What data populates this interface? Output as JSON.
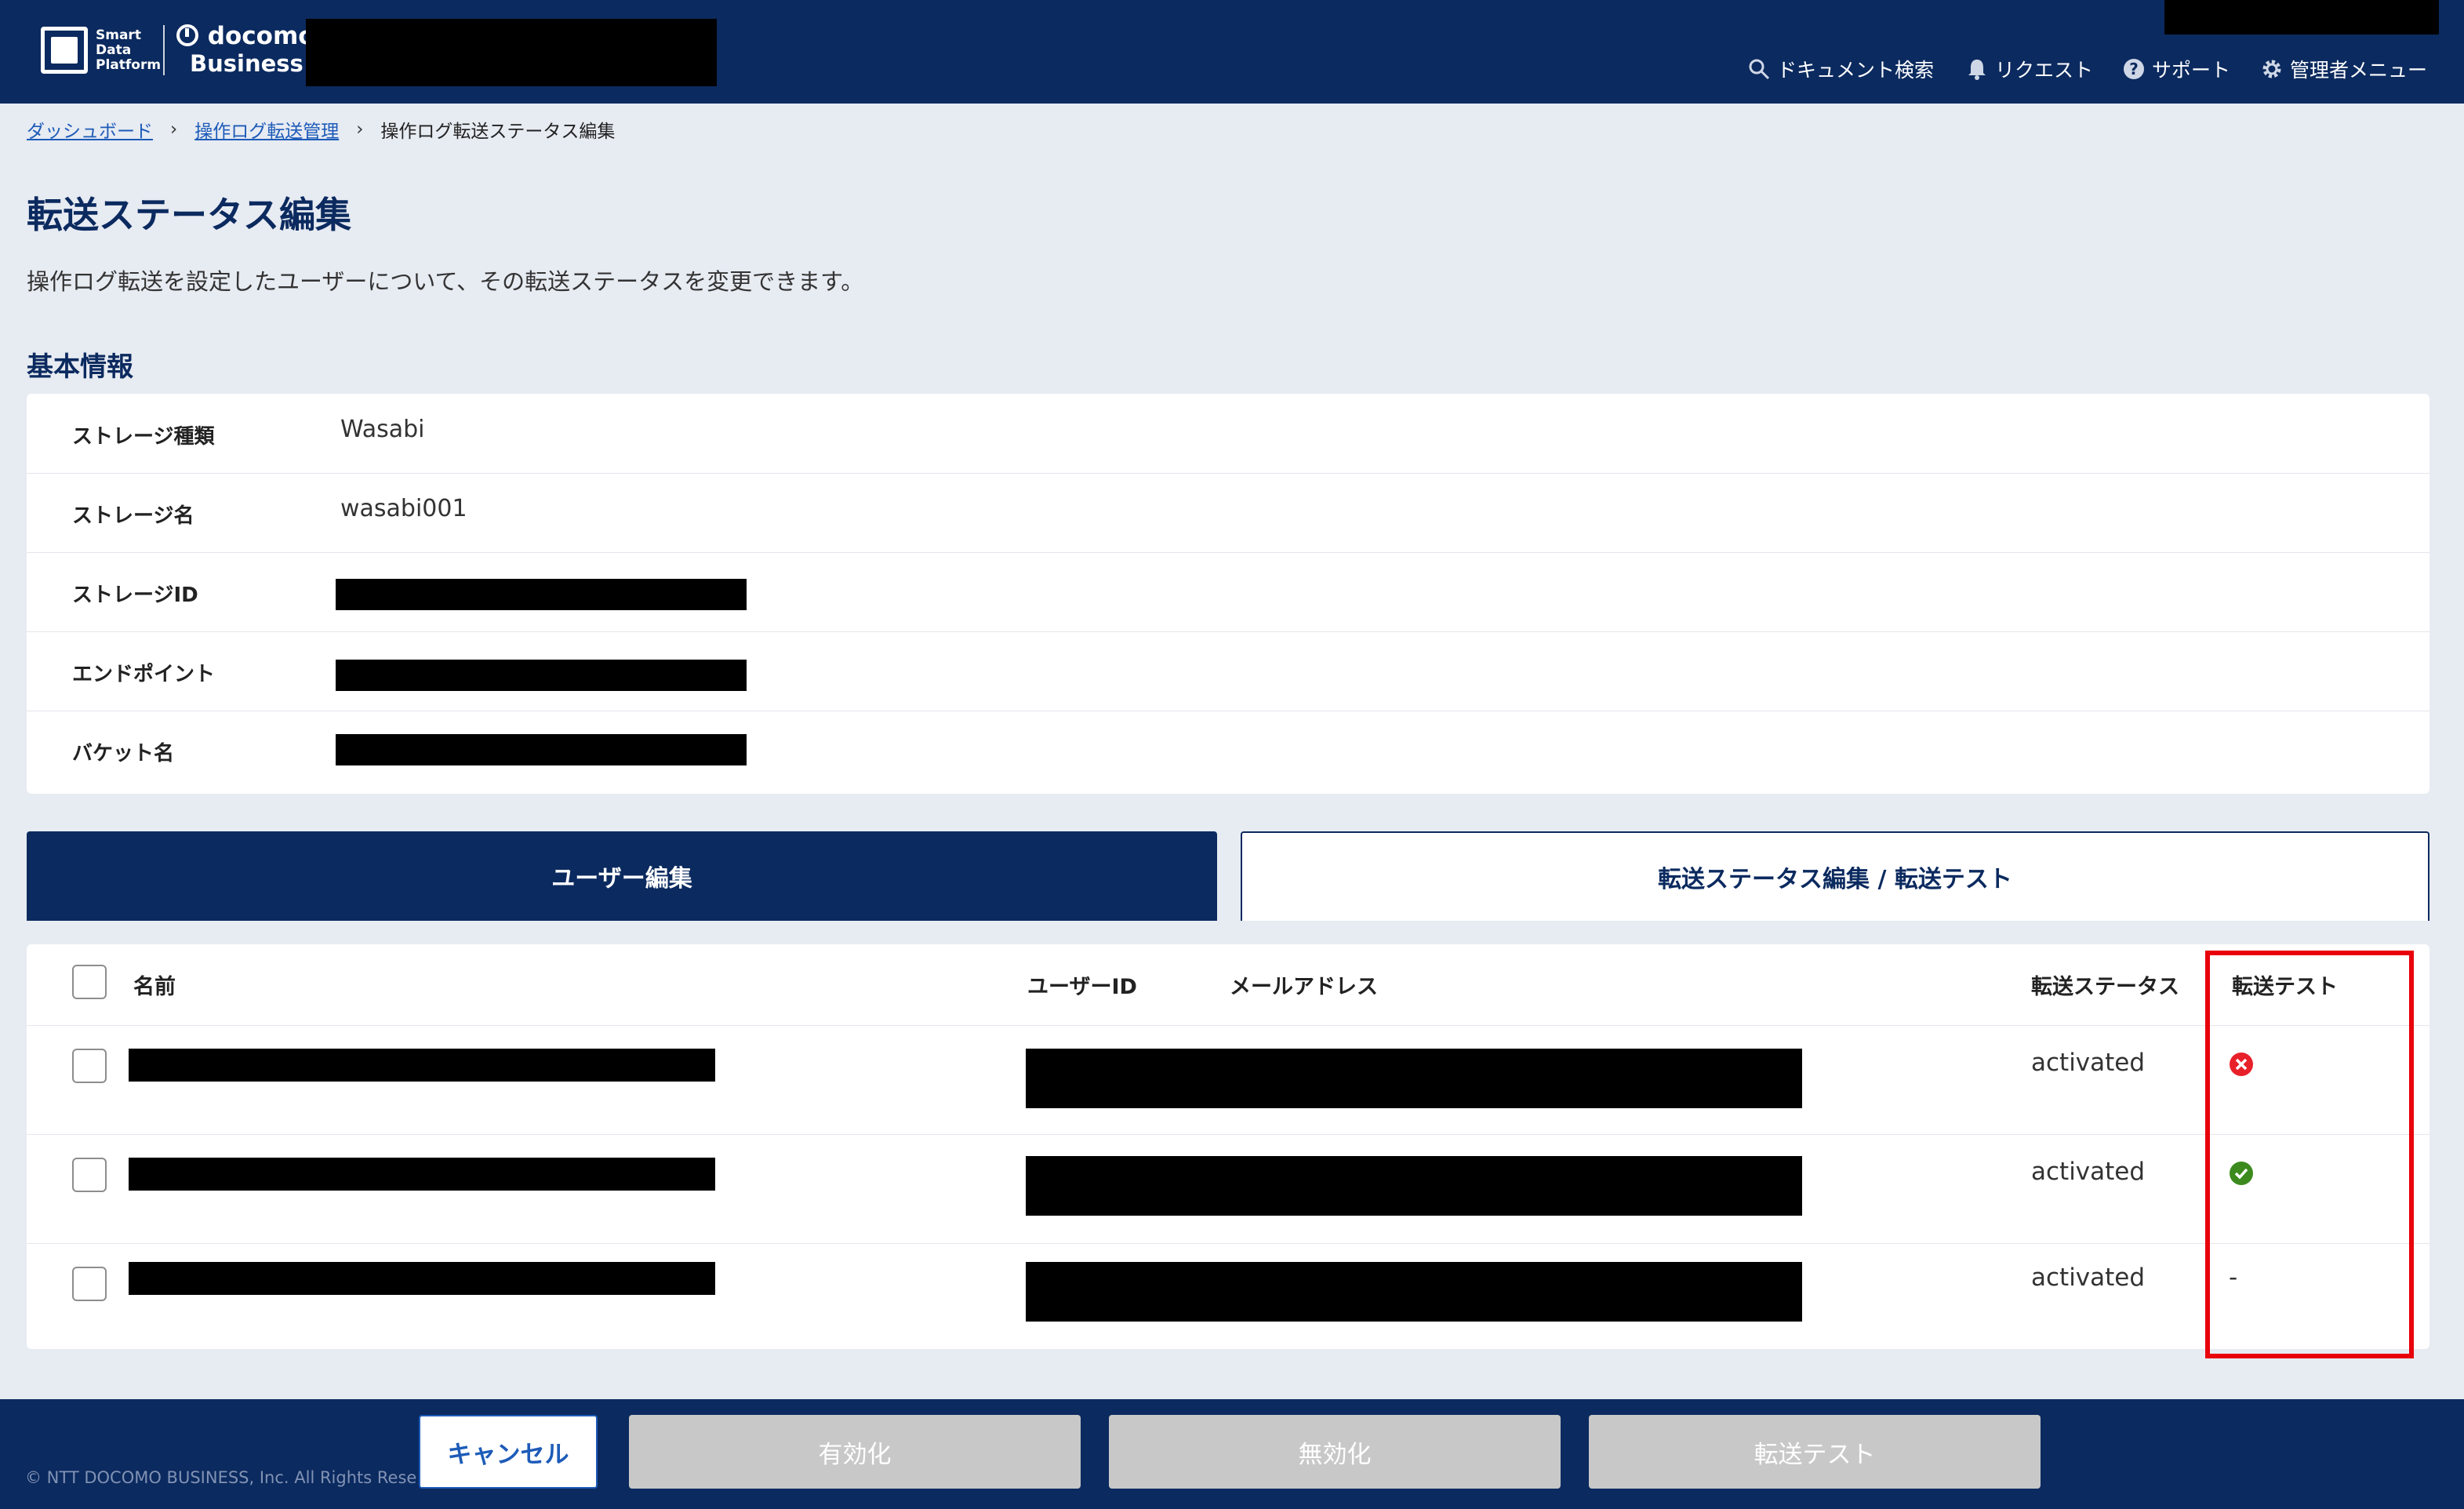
{
  "header": {
    "logo_line1": "Smart",
    "logo_line2": "Data",
    "logo_line3": "Platform",
    "brand_line1": "docomo",
    "brand_line2": "Business",
    "nav": [
      {
        "label": "ドキュメント検索",
        "icon": "search-icon"
      },
      {
        "label": "リクエスト",
        "icon": "bell-icon"
      },
      {
        "label": "サポート",
        "icon": "help-icon"
      },
      {
        "label": "管理者メニュー",
        "icon": "gear-icon"
      }
    ]
  },
  "breadcrumb": {
    "items": [
      "ダッシュボード",
      "操作ログ転送管理"
    ],
    "current": "操作ログ転送ステータス編集"
  },
  "page": {
    "title": "転送ステータス編集",
    "description": "操作ログ転送を設定したユーザーについて、その転送ステータスを変更できます。"
  },
  "basic_info": {
    "title": "基本情報",
    "rows": [
      {
        "label": "ストレージ種類",
        "value": "Wasabi"
      },
      {
        "label": "ストレージ名",
        "value": "wasabi001"
      },
      {
        "label": "ストレージID",
        "value": ""
      },
      {
        "label": "エンドポイント",
        "value": ""
      },
      {
        "label": "バケット名",
        "value": ""
      }
    ]
  },
  "tabs": {
    "users": "ユーザー編集",
    "status": "転送ステータス編集 / 転送テスト"
  },
  "table": {
    "headers": {
      "name": "名前",
      "user_id": "ユーザーID",
      "email": "メールアドレス",
      "status": "転送ステータス",
      "test": "転送テスト"
    },
    "rows": [
      {
        "status": "activated",
        "test_result": "error",
        "test_text": ""
      },
      {
        "status": "activated",
        "test_result": "success",
        "test_text": ""
      },
      {
        "status": "activated",
        "test_result": "none",
        "test_text": "-"
      }
    ]
  },
  "footer": {
    "copyright": "© NTT DOCOMO BUSINESS, Inc. All Rights Rese",
    "buttons": {
      "cancel": "キャンセル",
      "activate": "有効化",
      "deactivate": "無効化",
      "transfer_test": "転送テスト"
    }
  },
  "colors": {
    "navy": "#0b2a5f",
    "error": "#e8202a",
    "success": "#3c8a1e",
    "highlight": "#e8000b"
  }
}
